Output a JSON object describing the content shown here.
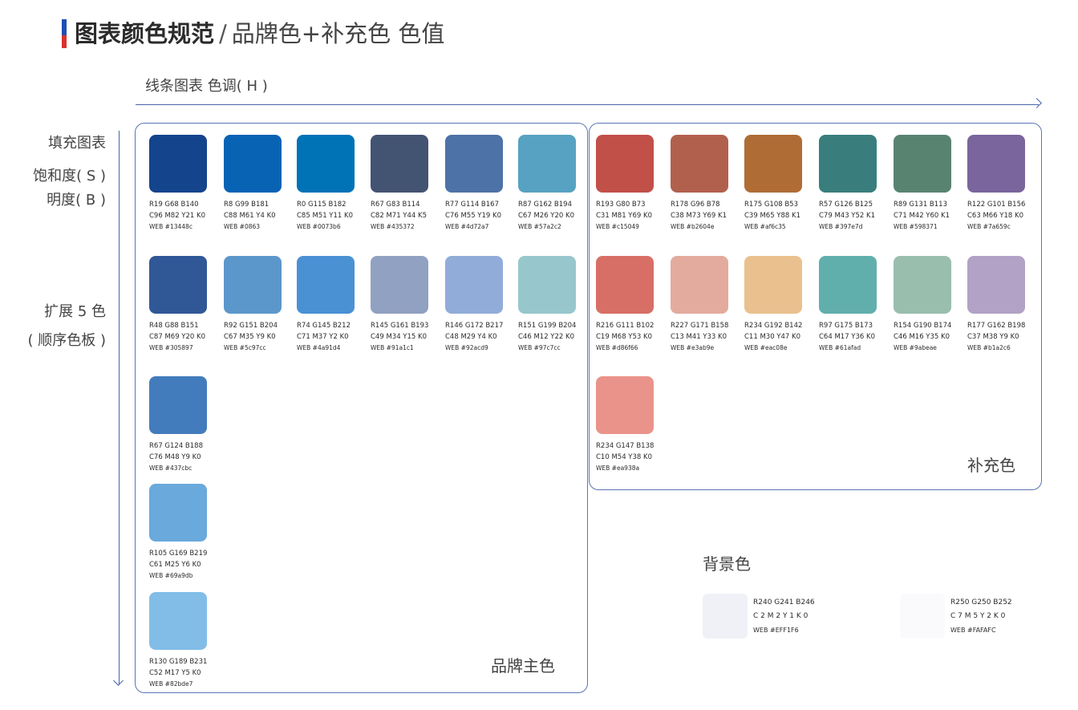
{
  "header": {
    "title_bold": "图表颜色规范",
    "title_sep": "/",
    "title_rest": "品牌色+补充色 色值"
  },
  "axes": {
    "horizontal_label": "线条图表 色调( H )"
  },
  "side_labels": {
    "fill_chart": "填充图表",
    "saturation": "饱和度( S )",
    "brightness": "明度( B )",
    "extend": "扩展 5 色",
    "sequential": "( 顺序色板 )"
  },
  "brand": {
    "label": "品牌主色",
    "primary": [
      {
        "hex": "#13448c",
        "rgb": "R19 G68 B140",
        "cmyk": "C96 M82 Y21 K0",
        "web": "WEB #13448c"
      },
      {
        "hex": "#0863b5",
        "rgb": "R8 G99 B181",
        "cmyk": "C88 M61 Y4 K0",
        "web": "WEB #0863"
      },
      {
        "hex": "#0073b6",
        "rgb": "R0 G115 B182",
        "cmyk": "C85 M51 Y11 K0",
        "web": "WEB #0073b6"
      },
      {
        "hex": "#435372",
        "rgb": "R67 G83 B114",
        "cmyk": "C82 M71 Y44 K5",
        "web": "WEB #435372"
      },
      {
        "hex": "#4d72a7",
        "rgb": "R77 G114 B167",
        "cmyk": "C76 M55 Y19 K0",
        "web": "WEB #4d72a7"
      },
      {
        "hex": "#57a2c2",
        "rgb": "R87 G162 B194",
        "cmyk": "C67 M26 Y20 K0",
        "web": "WEB #57a2c2"
      }
    ],
    "secondary": [
      {
        "hex": "#305897",
        "rgb": "R48 G88 B151",
        "cmyk": "C87 M69 Y20 K0",
        "web": "WEB #305897"
      },
      {
        "hex": "#5c97cc",
        "rgb": "R92 G151 B204",
        "cmyk": "C67 M35 Y9 K0",
        "web": "WEB #5c97cc"
      },
      {
        "hex": "#4a91d4",
        "rgb": "R74 G145 B212",
        "cmyk": "C71 M37 Y2 K0",
        "web": "WEB #4a91d4"
      },
      {
        "hex": "#91a1c1",
        "rgb": "R145 G161 B193",
        "cmyk": "C49 M34 Y15 K0",
        "web": "WEB #91a1c1"
      },
      {
        "hex": "#92acd9",
        "rgb": "R146 G172 B217",
        "cmyk": "C48 M29 Y4 K0",
        "web": "WEB #92acd9"
      },
      {
        "hex": "#97c7cc",
        "rgb": "R151 G199 B204",
        "cmyk": "C46 M12 Y22 K0",
        "web": "WEB #97c7cc"
      }
    ],
    "sequence": [
      {
        "hex": "#437cbc",
        "rgb": "R67 G124 B188",
        "cmyk": "C76 M48 Y9 K0",
        "web": "WEB #437cbc"
      },
      {
        "hex": "#69a9db",
        "rgb": "R105 G169 B219",
        "cmyk": "C61 M25 Y6 K0",
        "web": "WEB #69a9db"
      },
      {
        "hex": "#82bde7",
        "rgb": "R130 G189 B231",
        "cmyk": "C52 M17 Y5 K0",
        "web": "WEB #82bde7"
      }
    ]
  },
  "supplement": {
    "label": "补充色",
    "primary": [
      {
        "hex": "#c15049",
        "rgb": "R193 G80 B73",
        "cmyk": "C31 M81 Y69 K0",
        "web": "WEB #c15049"
      },
      {
        "hex": "#b2604e",
        "rgb": "R178 G96 B78",
        "cmyk": "C38 M73 Y69 K1",
        "web": "WEB #b2604e"
      },
      {
        "hex": "#af6c35",
        "rgb": "R175 G108 B53",
        "cmyk": "C39 M65 Y88 K1",
        "web": "WEB #af6c35"
      },
      {
        "hex": "#397e7d",
        "rgb": "R57 G126 B125",
        "cmyk": "C79 M43 Y52 K1",
        "web": "WEB #397e7d"
      },
      {
        "hex": "#598371",
        "rgb": "R89 G131 B113",
        "cmyk": "C71 M42 Y60 K1",
        "web": "WEB #598371"
      },
      {
        "hex": "#7a659c",
        "rgb": "R122 G101 B156",
        "cmyk": "C63 M66 Y18 K0",
        "web": "WEB #7a659c"
      }
    ],
    "secondary": [
      {
        "hex": "#d86f66",
        "rgb": "R216 G111 B102",
        "cmyk": "C19 M68 Y53 K0",
        "web": "WEB #d86f66"
      },
      {
        "hex": "#e3ab9e",
        "rgb": "R227 G171 B158",
        "cmyk": "C13 M41 Y33 K0",
        "web": "WEB #e3ab9e"
      },
      {
        "hex": "#eac08e",
        "rgb": "R234 G192 B142",
        "cmyk": "C11 M30 Y47 K0",
        "web": "WEB #eac08e"
      },
      {
        "hex": "#61afad",
        "rgb": "R97 G175 B173",
        "cmyk": "C64 M17 Y36 K0",
        "web": "WEB #61afad"
      },
      {
        "hex": "#9abeae",
        "rgb": "R154 G190 B174",
        "cmyk": "C46 M16 Y35 K0",
        "web": "WEB #9abeae"
      },
      {
        "hex": "#b1a2c6",
        "rgb": "R177 G162 B198",
        "cmyk": "C37 M38 Y9 K0",
        "web": "WEB #b1a2c6"
      }
    ],
    "sequence": [
      {
        "hex": "#ea938a",
        "rgb": "R234 G147 B138",
        "cmyk": "C10 M54 Y38 K0",
        "web": "WEB #ea938a"
      }
    ]
  },
  "background": {
    "heading": "背景色",
    "items": [
      {
        "hex": "#EFF1F6",
        "rgb": "R240 G241 B246",
        "cmyk": "C 2  M 2  Y 1   K 0",
        "web": "WEB #EFF1F6"
      },
      {
        "hex": "#FAFAFC",
        "rgb": "R250 G250 B252",
        "cmyk": "C 7  M 5  Y 2   K 0",
        "web": "WEB #FAFAFC"
      }
    ]
  }
}
